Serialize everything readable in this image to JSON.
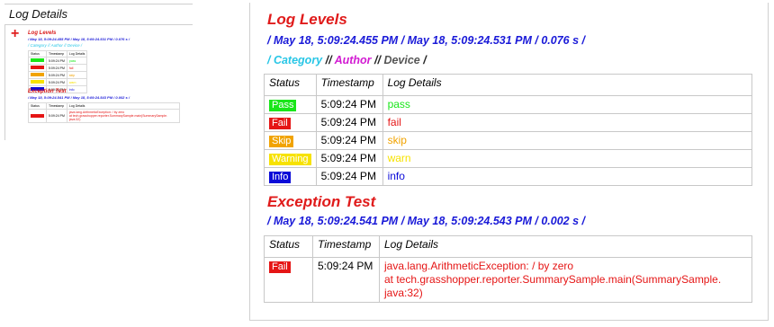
{
  "window_title": "Log Details",
  "columns": {
    "status": "Status",
    "timestamp": "Timestamp",
    "details": "Log Details"
  },
  "levels_test": {
    "title": "Log Levels",
    "times": "/ May 18, 5:09:24.455 PM / May 18, 5:09:24.531 PM / 0.076 s /",
    "meta_prefix": "/ ",
    "category": "Category",
    "sep1": " // ",
    "author": "Author",
    "sep2": " // ",
    "device": "Device",
    "meta_suffix": " /",
    "rows": [
      {
        "status": "Pass",
        "timestamp": "5:09:24 PM",
        "details": "pass",
        "color": "#19e619"
      },
      {
        "status": "Fail",
        "timestamp": "5:09:24 PM",
        "details": "fail",
        "color": "#e51515"
      },
      {
        "status": "Skip",
        "timestamp": "5:09:24 PM",
        "details": "skip",
        "color": "#f1a300"
      },
      {
        "status": "Warning",
        "timestamp": "5:09:24 PM",
        "details": "warn",
        "color": "#f7e200"
      },
      {
        "status": "Info",
        "timestamp": "5:09:24 PM",
        "details": "info",
        "color": "#0b0bd8"
      }
    ]
  },
  "exception_test": {
    "title": "Exception Test",
    "times": "/ May 18, 5:09:24.541 PM / May 18, 5:09:24.543 PM / 0.002 s /",
    "row": {
      "status": "Fail",
      "timestamp": "5:09:24 PM",
      "line1": "java.lang.ArithmeticException: / by zero",
      "line2": "at tech.grasshopper.reporter.SummarySample.main(SummarySample.",
      "line3": "java:32)",
      "color": "#e51515"
    }
  },
  "thumbnail": {
    "levels_times": "/ May 18, 5:09:24.455 PM / May 18, 5:09:24.531 PM / 0.076 s /",
    "meta": "/ Category // Author // Device /",
    "exception_times": "/ May 18, 5:09:24.541 PM / May 18, 5:09:24.543 PM / 0.002 s /",
    "exception_msg": "java.lang.ArithmeticException: / by zero",
    "exception_trace": "at tech.grasshopper.reporter.SummarySample.main(SummarySample.",
    "exception_trace2": "java:32)"
  }
}
